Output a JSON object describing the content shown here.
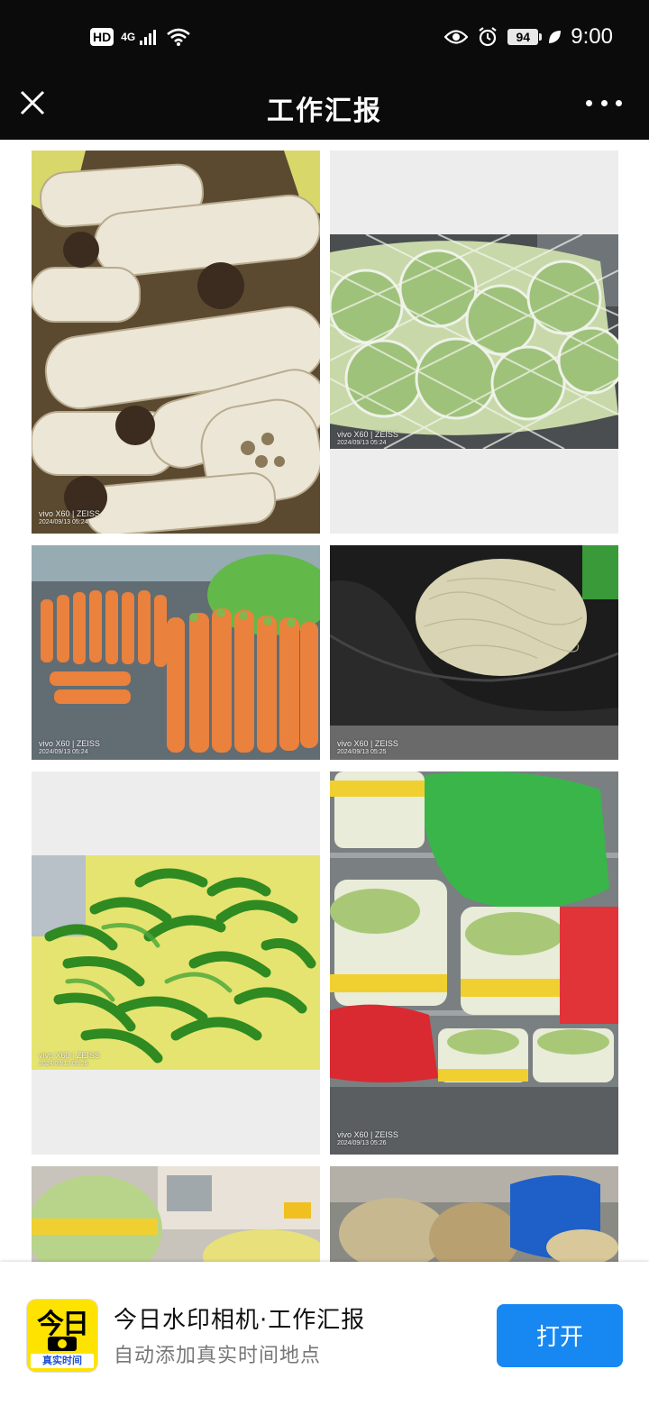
{
  "status_bar": {
    "hd": "HD",
    "network": "4G",
    "battery": "94",
    "time": "9:00"
  },
  "navbar": {
    "title": "工作汇报"
  },
  "photos": [
    {
      "model": "vivo X60 | ZEISS",
      "datetime": "2024/09/13 05:24"
    },
    {
      "model": "vivo X60 | ZEISS",
      "datetime": "2024/09/13 05:24"
    },
    {
      "model": "vivo X60 | ZEISS",
      "datetime": "2024/09/13 05:24"
    },
    {
      "model": "vivo X60 | ZEISS",
      "datetime": "2024/09/13 05:25"
    },
    {
      "model": "vivo X60 | ZEISS",
      "datetime": "2024/09/13 05:26"
    },
    {
      "model": "vivo X60 | ZEISS",
      "datetime": "2024/09/13 05:26"
    }
  ],
  "banner": {
    "icon_text": "今日",
    "icon_tag": "真实时间",
    "app_name": "今日水印相机·工作汇报",
    "subtitle": "自动添加真实时间地点",
    "open_label": "打开"
  },
  "colors": {
    "bar_bg": "#0b0b0b",
    "open_button": "#1788f2",
    "icon_yellow": "#ffe300"
  }
}
